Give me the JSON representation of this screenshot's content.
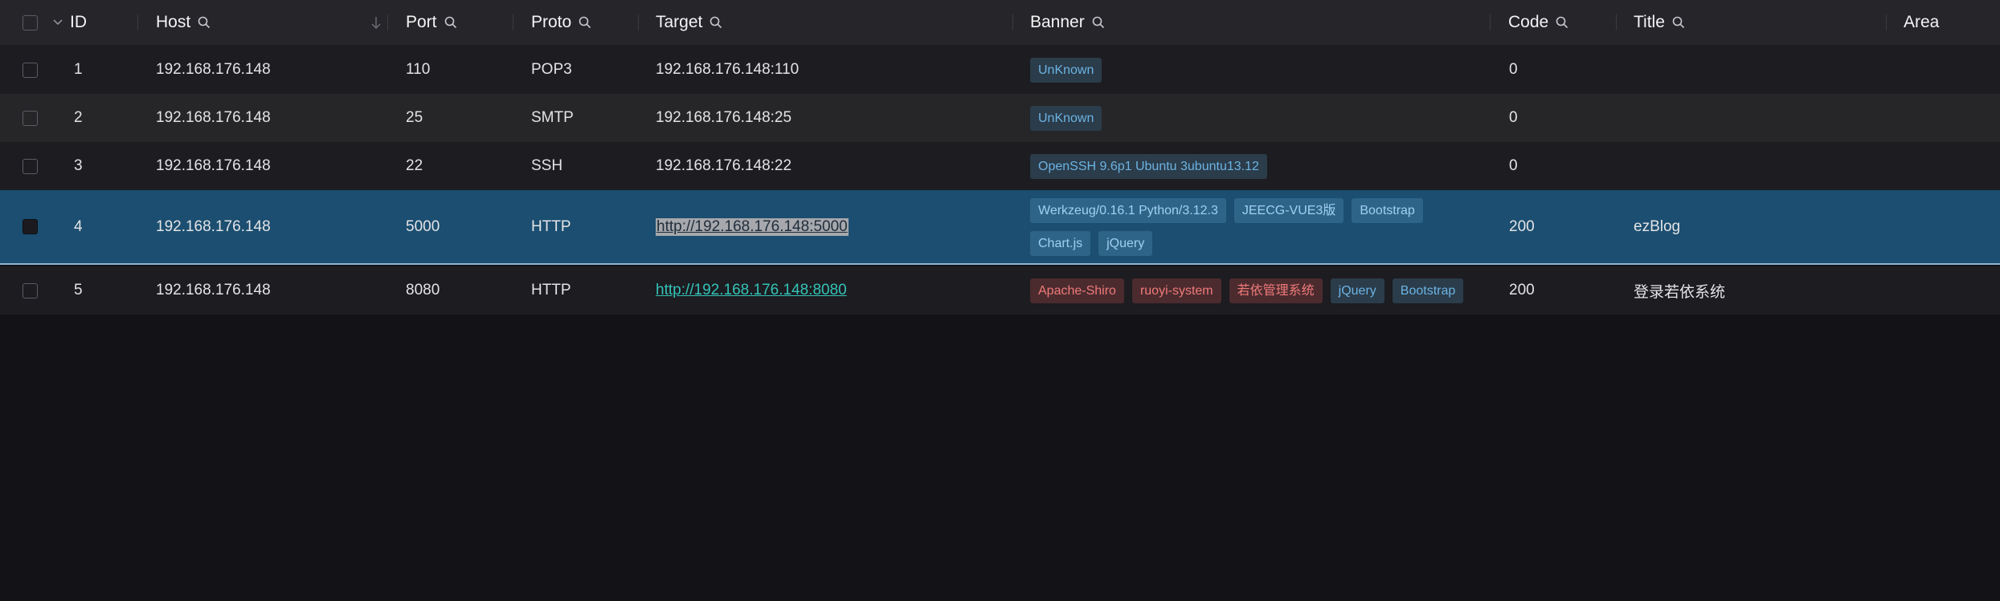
{
  "columns": {
    "id": "ID",
    "host": "Host",
    "port": "Port",
    "proto": "Proto",
    "target": "Target",
    "banner": "Banner",
    "code": "Code",
    "title": "Title",
    "area": "Area"
  },
  "rows": [
    {
      "id": "1",
      "host": "192.168.176.148",
      "port": "110",
      "proto": "POP3",
      "target": "192.168.176.148:110",
      "banner": [
        "UnKnown"
      ],
      "code": "0",
      "title": ""
    },
    {
      "id": "2",
      "host": "192.168.176.148",
      "port": "25",
      "proto": "SMTP",
      "target": "192.168.176.148:25",
      "banner": [
        "UnKnown"
      ],
      "code": "0",
      "title": ""
    },
    {
      "id": "3",
      "host": "192.168.176.148",
      "port": "22",
      "proto": "SSH",
      "target": "192.168.176.148:22",
      "banner": [
        "OpenSSH 9.6p1 Ubuntu 3ubuntu13.12"
      ],
      "code": "0",
      "title": ""
    },
    {
      "id": "4",
      "host": "192.168.176.148",
      "port": "5000",
      "proto": "HTTP",
      "target": "http://192.168.176.148:5000",
      "banner": [
        "Werkzeug/0.16.1 Python/3.12.3",
        "JEECG-VUE3版",
        "Bootstrap",
        "Chart.js",
        "jQuery"
      ],
      "code": "200",
      "title": "ezBlog",
      "checked": true
    },
    {
      "id": "5",
      "host": "192.168.176.148",
      "port": "8080",
      "proto": "HTTP",
      "target": "http://192.168.176.148:8080",
      "banner": [
        "Apache-Shiro",
        "ruoyi-system",
        "若依管理系统",
        "jQuery",
        "Bootstrap"
      ],
      "code": "200",
      "title": "登录若依系统"
    }
  ],
  "colors": {
    "background": "#121217",
    "header": "#25252a",
    "selected_row": "#1b4e70",
    "info_tag": "#6cb3e3",
    "danger_tag": "#ef7a7a",
    "link": "#34c3b6"
  },
  "icons": {
    "sort": "chevron-down-icon",
    "search": "search-icon",
    "sort_desc": "arrow-down-icon"
  }
}
